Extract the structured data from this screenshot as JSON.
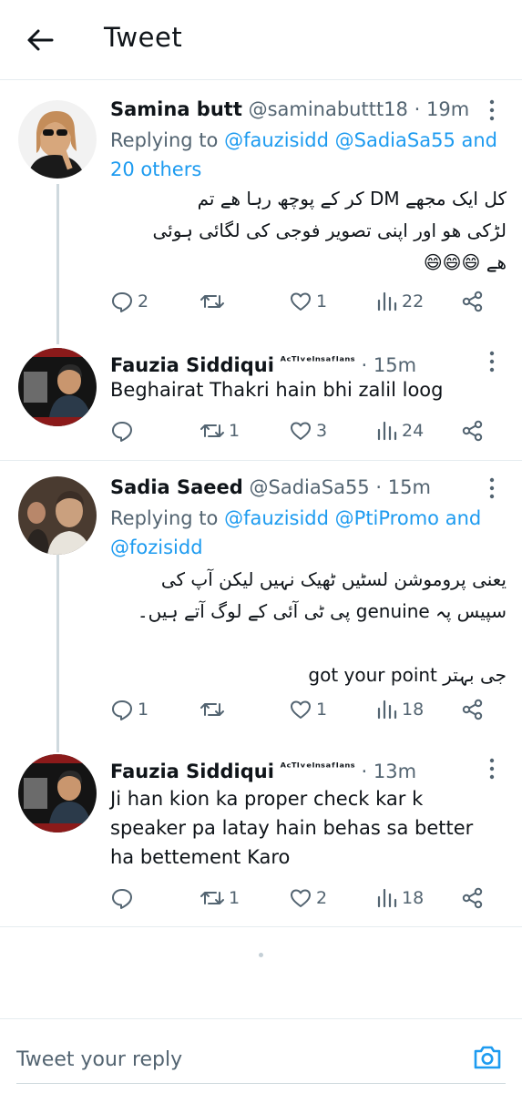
{
  "header": {
    "title": "Tweet",
    "back_icon": "arrow-left-icon"
  },
  "colors": {
    "accent": "#1d9bf0",
    "text": "#0f1419",
    "muted": "#536471",
    "border": "#e6ecf0"
  },
  "tweets": [
    {
      "name": "Samina butt",
      "handle": "@saminabuttt18",
      "dot": "·",
      "time": "19m",
      "replying_prefix": "Replying to",
      "replying_mentions": [
        "@fauzisidd",
        "@SadiaSa55"
      ],
      "replying_suffix": "and 20 others",
      "text_lines": [
        "کل ایک مجھے DM کر کے پوچھ رہا ھے تم",
        "لڑکی ھو اور اپنی تصویر فوجی کی لگائی ہوئی",
        "ھے 😄😄😄"
      ],
      "replies": "2",
      "retweets": "",
      "likes": "1",
      "views": "22"
    },
    {
      "name": "Fauzia Siddiqui",
      "badge": "ᴬᶜᵀᴵᵛᵉᴵⁿˢᵃᶠᴵᵃⁿˢ",
      "dot": "·",
      "time": "15m",
      "text": "Beghairat Thakri hain bhi zalil loog",
      "replies": "",
      "retweets": "1",
      "likes": "3",
      "views": "24"
    },
    {
      "name": "Sadia Saeed",
      "handle": "@SadiaSa55",
      "dot": "·",
      "time": "15m",
      "replying_prefix": "Replying to",
      "replying_mentions": [
        "@fauzisidd",
        "@PtiPromo"
      ],
      "replying_and": "and",
      "replying_last": "@fozisidd",
      "text_lines": [
        "یعنی پروموشن لسٹیں ٹھیک نہیں  لیکن آپ کی",
        "سپیس پہ genuine پی ٹی آئی کے لوگ آتے ہیں۔",
        "",
        "جی بہتر got your point"
      ],
      "replies": "1",
      "retweets": "",
      "likes": "1",
      "views": "18"
    },
    {
      "name": "Fauzia Siddiqui",
      "badge": "ᴬᶜᵀᴵᵛᵉᴵⁿˢᵃᶠᴵᵃⁿˢ",
      "dot": "·",
      "time": "13m",
      "text": "Ji han kion ka proper check kar k speaker pa latay hain behas sa better ha bettement Karo",
      "replies": "",
      "retweets": "1",
      "likes": "2",
      "views": "18"
    }
  ],
  "composer": {
    "placeholder": "Tweet your reply",
    "camera_icon": "camera-icon"
  }
}
